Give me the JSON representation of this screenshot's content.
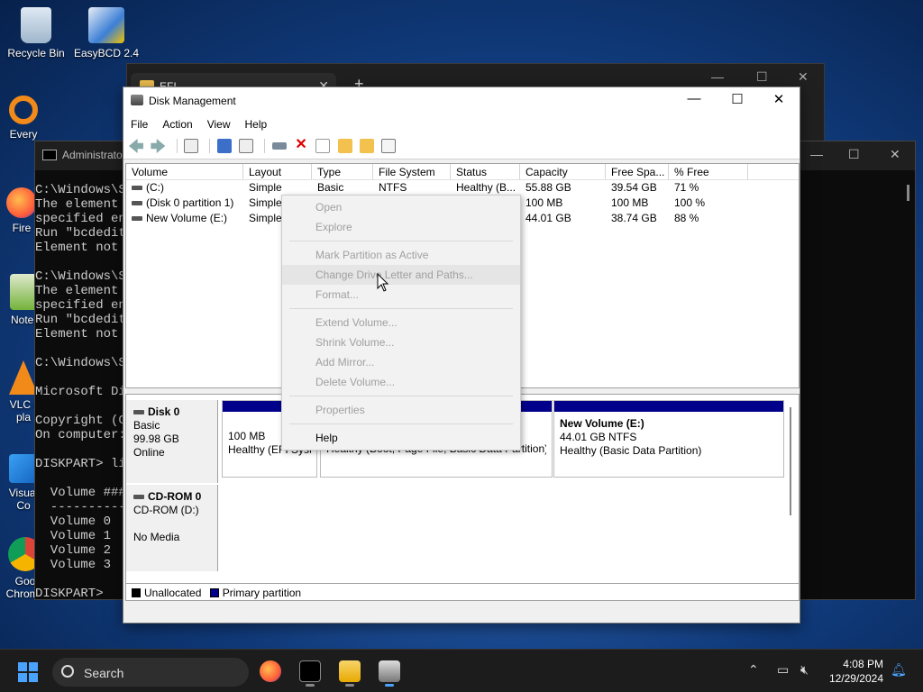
{
  "desktop": {
    "icons": [
      {
        "label": "Recycle Bin"
      },
      {
        "label": "EasyBCD 2.4"
      },
      {
        "label": "Every"
      },
      {
        "label": "Fire"
      },
      {
        "label": "Notep"
      },
      {
        "label": "VLC r\npla"
      },
      {
        "label": "Visual\nCo"
      },
      {
        "label": "Goo\nChrome"
      }
    ]
  },
  "explorer": {
    "tab_title": "EFI"
  },
  "cmd": {
    "title": "Administrato",
    "lines": "C:\\Windows\\S\nThe element\nspecified en\nRun \"bcdedit\nElement not\n\nC:\\Windows\\S\nThe element\nspecified en\nRun \"bcdedit\nElement not\n\nC:\\Windows\\S\n\nMicrosoft Di\n\nCopyright (C\nOn computer:\n\nDISKPART> li\n\n  Volume ###\n  ----------\n  Volume 0\n  Volume 1\n  Volume 2\n  Volume 3\n\nDISKPART>"
  },
  "disk_management": {
    "title": "Disk Management",
    "menu": [
      "File",
      "Action",
      "View",
      "Help"
    ],
    "columns": [
      "Volume",
      "Layout",
      "Type",
      "File System",
      "Status",
      "Capacity",
      "Free Spa...",
      "% Free"
    ],
    "volumes": [
      {
        "volume": "(C:)",
        "layout": "Simple",
        "type": "Basic",
        "fs": "NTFS",
        "status": "Healthy (B...",
        "capacity": "55.88 GB",
        "free": "39.54 GB",
        "pct": "71 %"
      },
      {
        "volume": "(Disk 0 partition 1)",
        "layout": "Simple",
        "type": "",
        "fs": "",
        "status": "",
        "capacity": "100 MB",
        "free": "100 MB",
        "pct": "100 %"
      },
      {
        "volume": "New Volume (E:)",
        "layout": "Simple",
        "type": "",
        "fs": "",
        "status": "",
        "capacity": "44.01 GB",
        "free": "38.74 GB",
        "pct": "88 %"
      }
    ],
    "disk0": {
      "name": "Disk 0",
      "type": "Basic",
      "size": "99.98 GB",
      "status": "Online"
    },
    "part_efi": {
      "size": "100 MB",
      "status": "Healthy (EFI Syste"
    },
    "part_c": {
      "status": "Healthy (Boot, Page File, Basic Data Partition)"
    },
    "part_e": {
      "name": "New Volume  (E:)",
      "size": "44.01 GB NTFS",
      "status": "Healthy (Basic Data Partition)"
    },
    "cdrom": {
      "name": "CD-ROM 0",
      "drive": "CD-ROM (D:)",
      "media": "No Media"
    },
    "legend": {
      "unallocated": "Unallocated",
      "primary": "Primary partition"
    }
  },
  "context_menu": {
    "items": [
      "Open",
      "Explore",
      "Mark Partition as Active",
      "Change Drive Letter and Paths...",
      "Format...",
      "Extend Volume...",
      "Shrink Volume...",
      "Add Mirror...",
      "Delete Volume...",
      "Properties",
      "Help"
    ]
  },
  "taskbar": {
    "search_label": "Search",
    "time": "4:08 PM",
    "date": "12/29/2024"
  },
  "colors": {
    "primary_partition": "#00008b",
    "accent": "#4aa3ff"
  }
}
